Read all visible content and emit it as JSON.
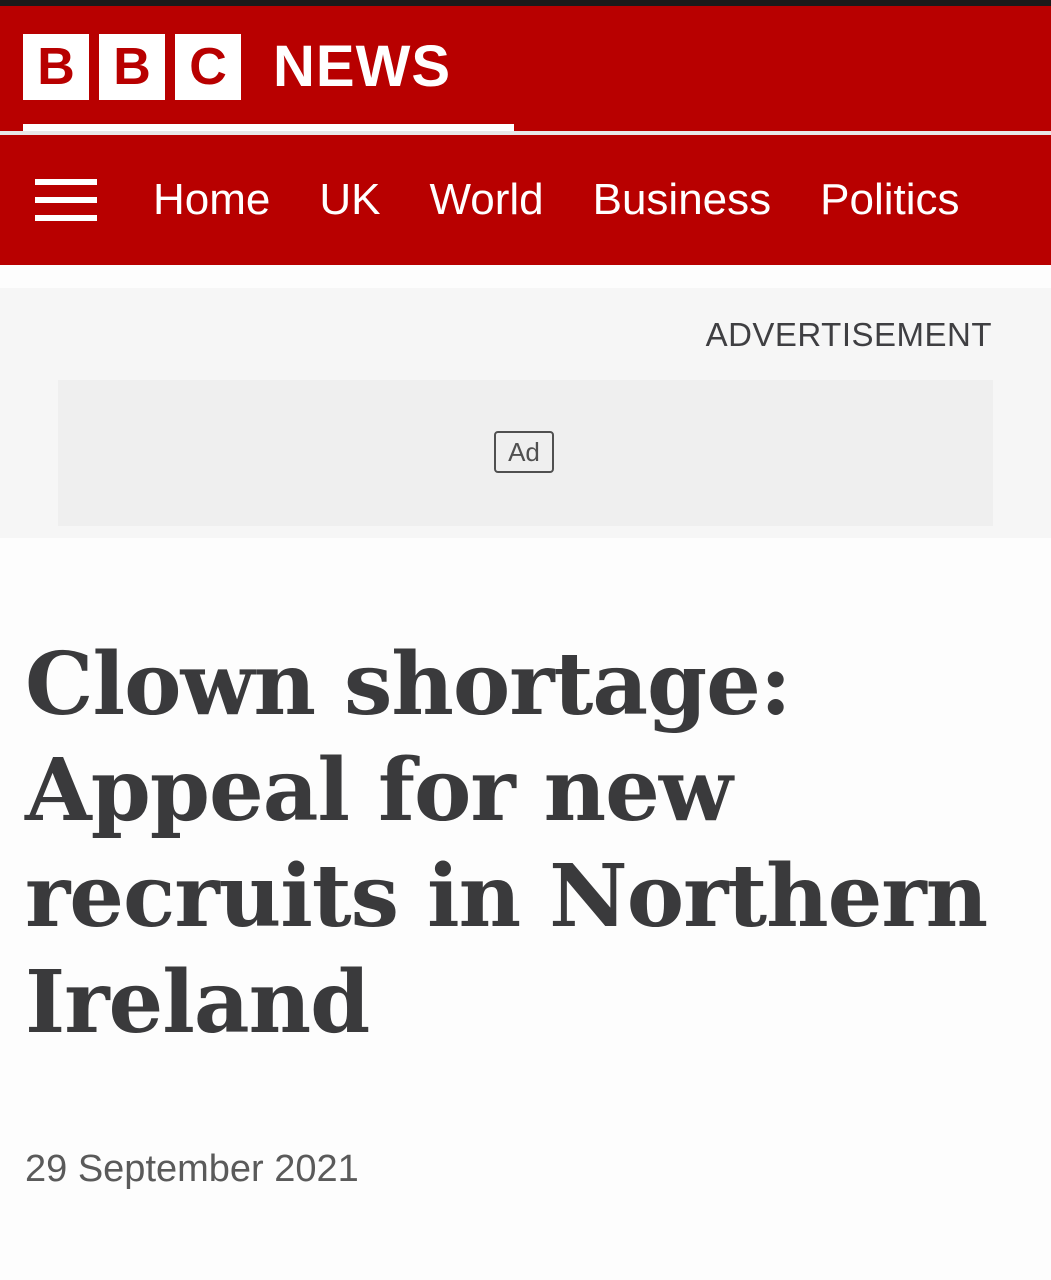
{
  "brand": {
    "logo_letters": [
      "B",
      "B",
      "C"
    ],
    "news_word": "NEWS",
    "primary_color": "#b80000"
  },
  "nav": {
    "menu_icon": "hamburger-menu-icon",
    "items": [
      {
        "label": "Home"
      },
      {
        "label": "UK"
      },
      {
        "label": "World"
      },
      {
        "label": "Business"
      },
      {
        "label": "Politics"
      }
    ]
  },
  "advertisement": {
    "label": "ADVERTISEMENT",
    "badge": "Ad"
  },
  "article": {
    "headline": "Clown shortage: Appeal for new recruits in Northern Ireland",
    "date": "29 September 2021"
  }
}
